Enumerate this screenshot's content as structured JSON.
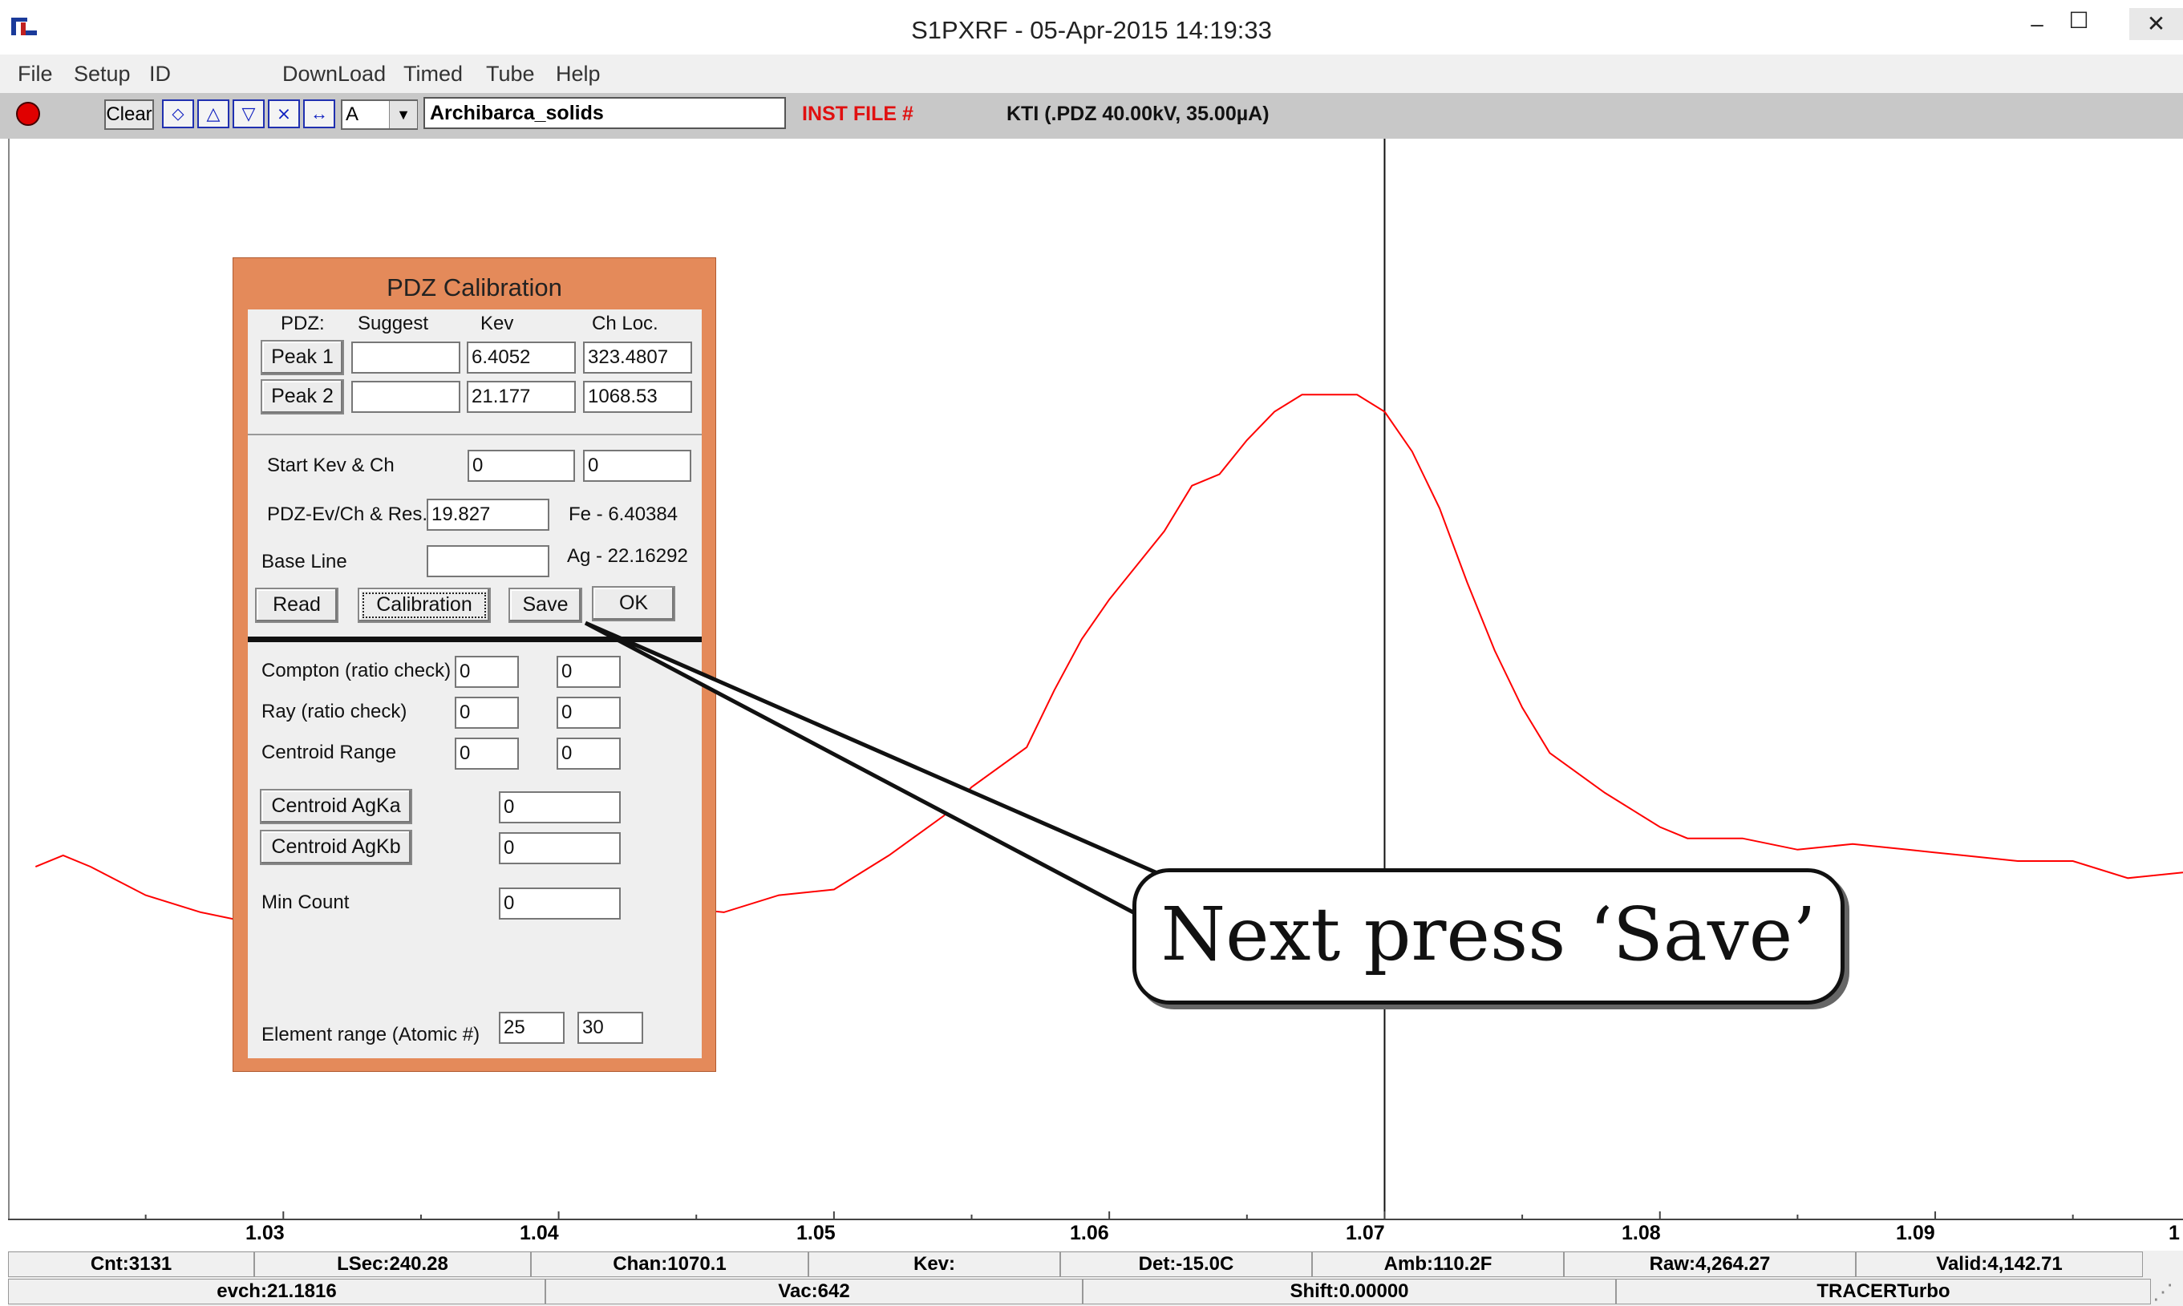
{
  "window": {
    "title": "S1PXRF - 05-Apr-2015 14:19:33",
    "minimize": "–",
    "maximize": "☐",
    "close": "✕"
  },
  "menu": [
    "File",
    "Setup",
    "ID",
    "DownLoad",
    "Timed",
    "Tube",
    "Help"
  ],
  "toolbar": {
    "clear_label": "Clear",
    "combo_value": "A",
    "file_name": "Archibarca_solids",
    "inst_file_label": "INST FILE #",
    "kti_label": "KTI  (.PDZ 40.00kV, 35.00µA)",
    "icons": [
      "save-icon",
      "up-icon",
      "down-icon",
      "collapse-icon",
      "expand-icon"
    ]
  },
  "plot": {
    "line_color": "#ff0000",
    "cursor_x": 1.07,
    "x_ticks": [
      "1.03",
      "1.04",
      "1.05",
      "1.06",
      "1.07",
      "1.08",
      "1.09",
      "1"
    ]
  },
  "chart_data": {
    "type": "line",
    "x": [
      1.021,
      1.022,
      1.023,
      1.025,
      1.027,
      1.029,
      1.031,
      1.033,
      1.035,
      1.036,
      1.038,
      1.04,
      1.042,
      1.044,
      1.046,
      1.048,
      1.05,
      1.052,
      1.054,
      1.055,
      1.057,
      1.058,
      1.059,
      1.06,
      1.061,
      1.062,
      1.063,
      1.064,
      1.065,
      1.066,
      1.067,
      1.068,
      1.069,
      1.07,
      1.071,
      1.072,
      1.073,
      1.074,
      1.075,
      1.076,
      1.078,
      1.079,
      1.08,
      1.081,
      1.083,
      1.085,
      1.087,
      1.089,
      1.091,
      1.093,
      1.095,
      1.097,
      1.099
    ],
    "y": [
      0.17,
      0.19,
      0.17,
      0.12,
      0.09,
      0.07,
      0.08,
      0.05,
      0.03,
      0.05,
      0.07,
      0.08,
      0.07,
      0.1,
      0.09,
      0.12,
      0.13,
      0.19,
      0.26,
      0.31,
      0.38,
      0.48,
      0.57,
      0.64,
      0.7,
      0.76,
      0.84,
      0.86,
      0.92,
      0.97,
      1.0,
      1.0,
      1.0,
      0.97,
      0.9,
      0.8,
      0.67,
      0.55,
      0.45,
      0.37,
      0.3,
      0.27,
      0.24,
      0.22,
      0.22,
      0.2,
      0.21,
      0.2,
      0.19,
      0.18,
      0.18,
      0.15,
      0.16
    ],
    "xlim": [
      1.02,
      1.099
    ],
    "ylim": [
      -0.45,
      1.45
    ]
  },
  "dialog": {
    "title": "PDZ Calibration",
    "headers": [
      "PDZ:",
      "Suggest",
      "Kev",
      "Ch Loc."
    ],
    "peak1": {
      "label": "Peak 1",
      "suggest": "",
      "kev": "6.4052",
      "ch": "323.4807"
    },
    "peak2": {
      "label": "Peak 2",
      "suggest": "",
      "kev": "21.177",
      "ch": "1068.53"
    },
    "start_label": "Start Kev & Ch",
    "start_kev": "0",
    "start_ch": "0",
    "evch_label": "PDZ-Ev/Ch & Res.",
    "evch_value": "19.827",
    "fe_text": "Fe - 6.40384",
    "baseline_label": "Base Line",
    "baseline_value": "",
    "ag_text": "Ag - 22.16292",
    "btn_read": "Read",
    "btn_calibration": "Calibration",
    "btn_save": "Save",
    "btn_ok": "OK",
    "compton_label": "Compton (ratio check)",
    "compton_a": "0",
    "compton_b": "0",
    "ray_label": "Ray (ratio check)",
    "ray_a": "0",
    "ray_b": "0",
    "centroid_label": "Centroid Range",
    "centroid_a": "0",
    "centroid_b": "0",
    "agka_btn": "Centroid AgKa",
    "agka_value": "0",
    "agkb_btn": "Centroid AgKb",
    "agkb_value": "0",
    "mincount_label": "Min Count",
    "mincount_value": "0",
    "element_label": "Element range (Atomic #)",
    "element_min": "25",
    "element_max": "30"
  },
  "callout": {
    "text": "Next press ‘Save’"
  },
  "status": {
    "row1": [
      "Cnt:3131",
      "LSec:240.28",
      "Chan:1070.1",
      "Kev:",
      "Det:-15.0C",
      "Amb:110.2F",
      "Raw:4,264.27",
      "Valid:4,142.71"
    ],
    "row2": [
      "evch:21.1816",
      "Vac:642",
      "Shift:0.00000",
      "TRACERTurbo"
    ]
  }
}
